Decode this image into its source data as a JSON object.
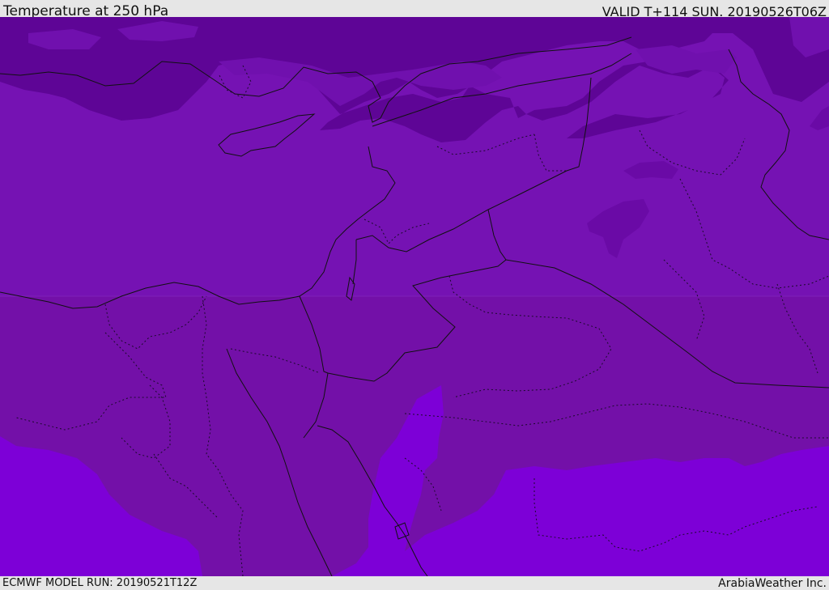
{
  "header": {
    "title": "Temperature at 250 hPa",
    "valid": "VALID T+114 SUN. 20190526T06Z"
  },
  "footer": {
    "model_run": "ECMWF MODEL RUN: 20190521T12Z",
    "credit": "ArabiaWeather Inc."
  },
  "colors": {
    "cold_deep": "#5e0596",
    "cold": "#7010ae",
    "mid": "#7310a8",
    "warm": "#7d00d7",
    "border": "#111111"
  },
  "icons": [
    "none"
  ]
}
